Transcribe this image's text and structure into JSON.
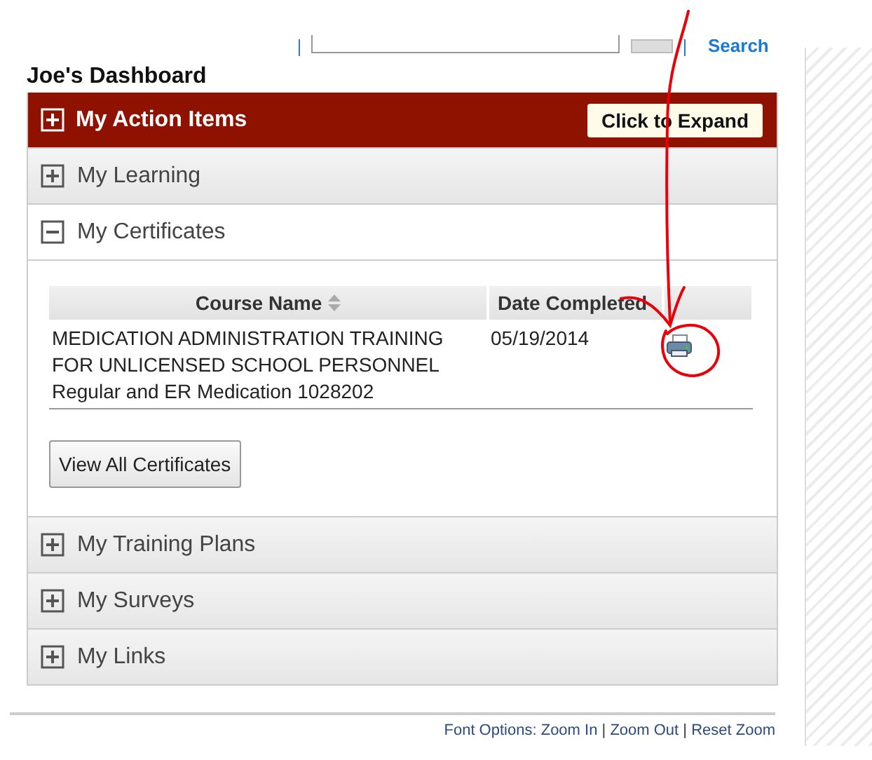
{
  "search": {
    "link": "Search"
  },
  "dashboard": {
    "title": "Joe's Dashboard"
  },
  "sections": [
    {
      "kind": "header",
      "title": "My Action Items",
      "button": "Click to Expand",
      "expanded": false
    },
    {
      "kind": "section",
      "title": "My Learning",
      "expanded": false
    },
    {
      "kind": "section",
      "title": "My Certificates",
      "expanded": true,
      "table": {
        "columns": [
          {
            "label": "Course Name",
            "sortable": true
          },
          {
            "label": "Date Completed",
            "sortable": false
          }
        ],
        "rows": [
          {
            "course": [
              "MEDICATION ADMINISTRATION TRAINING",
              "FOR UNLICENSED SCHOOL PERSONNEL",
              "Regular and ER Medication 1028202"
            ],
            "date": "05/19/2014"
          }
        ]
      },
      "button": "View All Certificates"
    },
    {
      "kind": "section",
      "title": "My Training Plans",
      "expanded": false
    },
    {
      "kind": "section",
      "title": "My Surveys",
      "expanded": false
    },
    {
      "kind": "section",
      "title": "My Links",
      "expanded": false
    }
  ],
  "footer": {
    "label": "Font Options:",
    "items": [
      {
        "kind": "link",
        "text": "Zoom In"
      },
      {
        "kind": "separator",
        "text": "|"
      },
      {
        "kind": "link",
        "text": "Zoom Out"
      },
      {
        "kind": "separator",
        "text": "|"
      },
      {
        "kind": "link",
        "text": "Reset Zoom"
      }
    ]
  }
}
